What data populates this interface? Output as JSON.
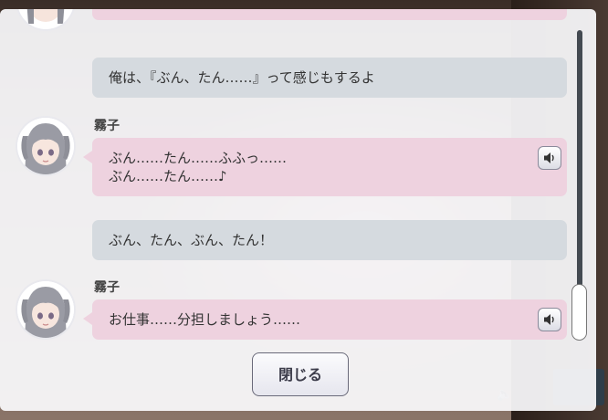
{
  "log": {
    "messages": [
      {
        "kind": "player",
        "text": "俺は、『ぶん、たん……』って感じもするよ"
      },
      {
        "kind": "npc",
        "speaker": "霧子",
        "text": "ぶん……たん……ふふっ……\nぶん……たん……♪"
      },
      {
        "kind": "player",
        "text": "ぶん、たん、ぶん、たん！"
      },
      {
        "kind": "npc",
        "speaker": "霧子",
        "text": "お仕事……分担しましょう……"
      }
    ],
    "close_label": "閉じる"
  },
  "colors": {
    "player_bubble": "#d5dadf",
    "npc_bubble": "#eed2df",
    "dialog_bg": "#fafafc"
  },
  "icons": {
    "voice": "speaker-icon",
    "avatar": "character-avatar-icon"
  }
}
